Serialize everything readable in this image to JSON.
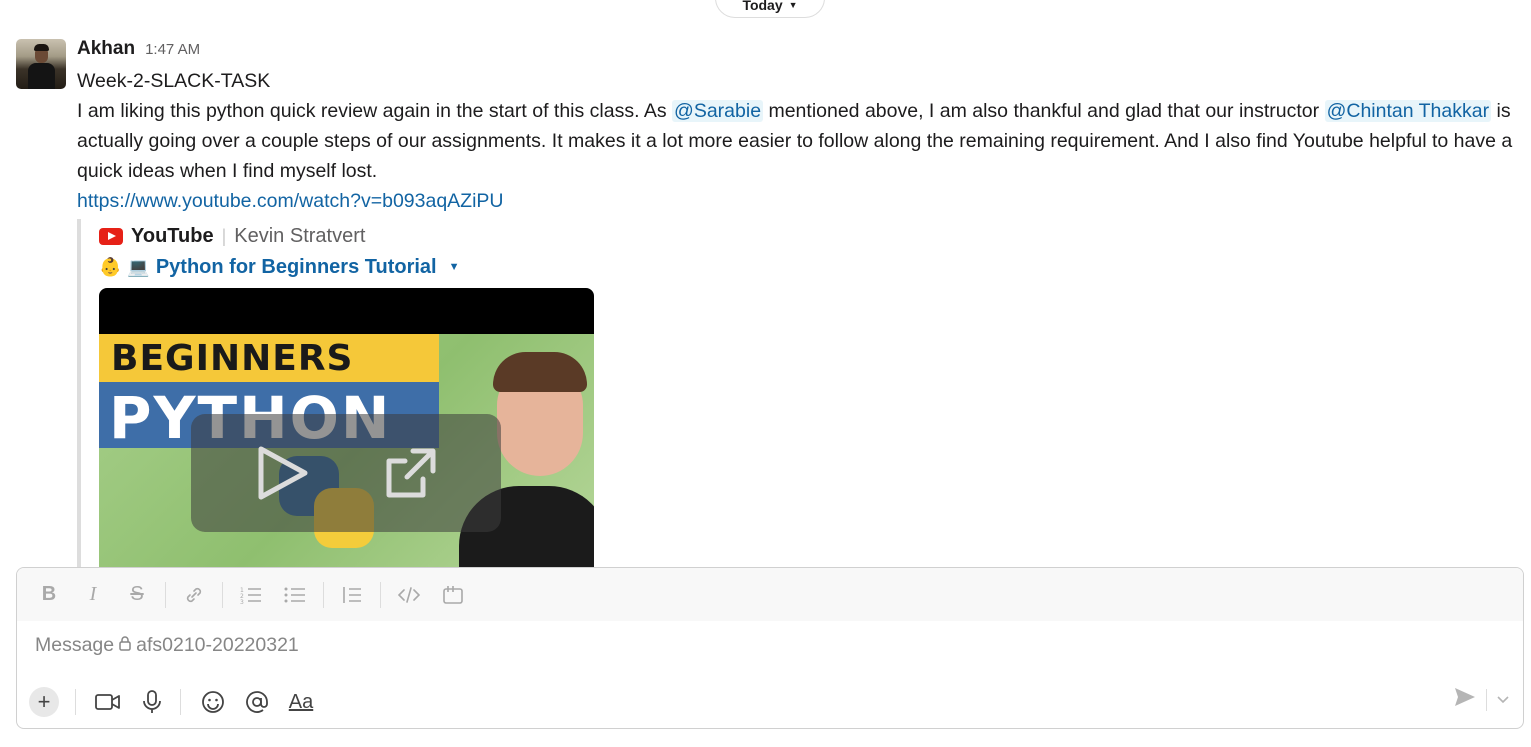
{
  "day_divider": {
    "label": "Today",
    "icon": "chevron-down-icon"
  },
  "message": {
    "author": "Akhan",
    "time": "1:47 AM",
    "title": "Week-2-SLACK-TASK",
    "body": {
      "part1": "I am liking this python quick review again in the start of this class. As ",
      "mention1": "@Sarabie",
      "part2": " mentioned above, I am also thankful and glad that our instructor ",
      "mention2": "@Chintan Thakkar",
      "part3": " is actually going over a couple steps of our assignments. It makes it a lot more easier to follow along the remaining requirement. And I also find Youtube helpful to have a quick ideas when I find myself lost."
    },
    "link": "https://www.youtube.com/watch?v=b093aqAZiPU",
    "unfurl": {
      "source": "YouTube",
      "author": "Kevin Stratvert",
      "emoji1": "👶",
      "emoji2": "💻",
      "title": "Python for Beginners Tutorial",
      "thumbnail_text_1": "BEGINNERS",
      "thumbnail_text_2": "PYTHON",
      "icons": [
        "play-icon",
        "open-external-icon"
      ]
    }
  },
  "composer": {
    "placeholder_prefix": "Message",
    "channel": "afs0210-20220321",
    "format_buttons": [
      "bold-icon",
      "italic-icon",
      "strikethrough-icon",
      "link-icon",
      "ordered-list-icon",
      "bulleted-list-icon",
      "blockquote-icon",
      "code-icon",
      "code-block-icon"
    ],
    "bottom_buttons": [
      "plus-icon",
      "video-icon",
      "microphone-icon",
      "emoji-icon",
      "mention-icon",
      "formatting-toggle"
    ],
    "format_toggle_label": "Aa",
    "send_icon": "send-icon"
  },
  "colors": {
    "link": "#1264a3",
    "mention_bg": "#e8f5fa",
    "youtube_red": "#e62117"
  }
}
